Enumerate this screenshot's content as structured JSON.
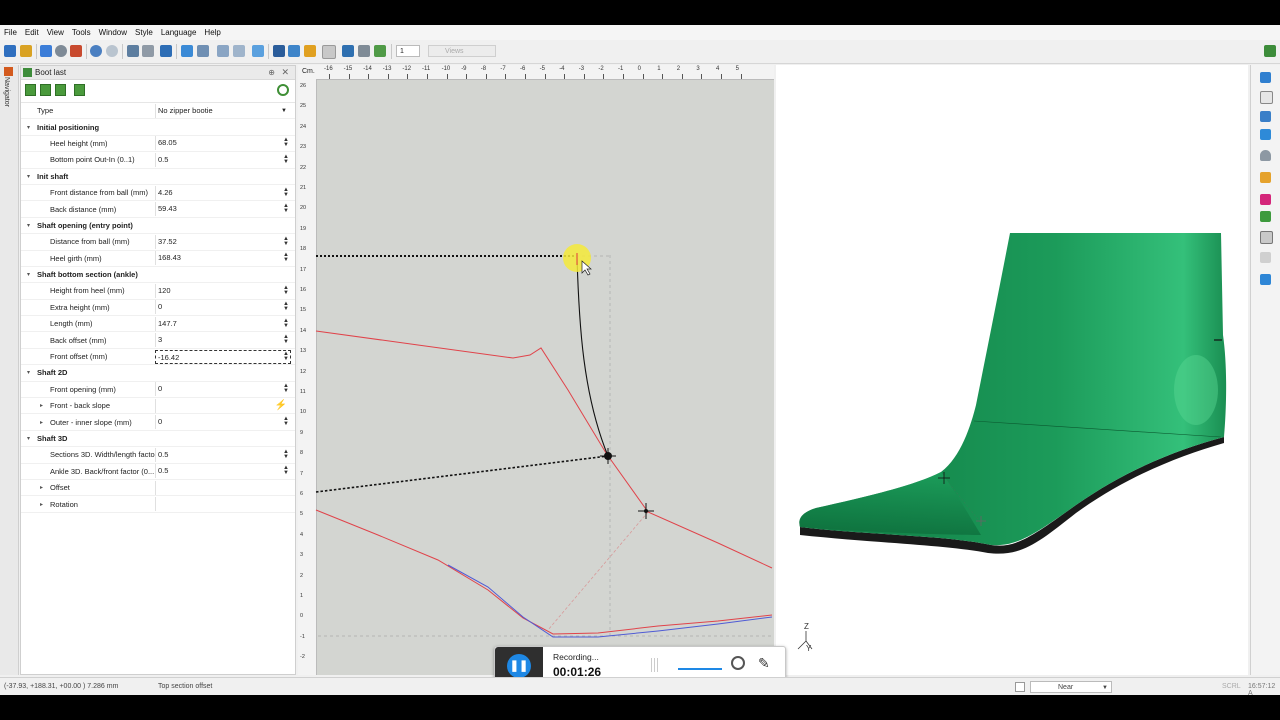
{
  "menu": [
    "File",
    "Edit",
    "View",
    "Tools",
    "Window",
    "Style",
    "Language",
    "Help"
  ],
  "toolbar": {
    "step_value": "1",
    "views_label": "Views"
  },
  "navigator_tab": "Navigator",
  "panel": {
    "title": "Boot last",
    "rows": [
      {
        "kind": "prop",
        "label": "Type",
        "value": "No zipper bootie",
        "control": "dropdown"
      },
      {
        "kind": "cat",
        "label": "Initial positioning"
      },
      {
        "kind": "prop",
        "label": "Heel height (mm)",
        "value": "68.05",
        "control": "spin"
      },
      {
        "kind": "prop",
        "label": "Bottom point Out-In (0..1)",
        "value": "0.5",
        "control": "spin"
      },
      {
        "kind": "cat",
        "label": "Init shaft"
      },
      {
        "kind": "prop",
        "label": "Front distance from ball (mm)",
        "value": "4.26",
        "control": "spin"
      },
      {
        "kind": "prop",
        "label": "Back distance (mm)",
        "value": "59.43",
        "control": "spin"
      },
      {
        "kind": "cat",
        "label": "Shaft opening (entry point)"
      },
      {
        "kind": "prop",
        "label": "Distance from ball (mm)",
        "value": "37.52",
        "control": "spin"
      },
      {
        "kind": "prop",
        "label": "Heel girth (mm)",
        "value": "168.43",
        "control": "spin"
      },
      {
        "kind": "cat",
        "label": "Shaft bottom section (ankle)"
      },
      {
        "kind": "prop",
        "label": "Height from heel (mm)",
        "value": "120",
        "control": "spin"
      },
      {
        "kind": "prop",
        "label": "Extra height (mm)",
        "value": "0",
        "control": "spin"
      },
      {
        "kind": "prop",
        "label": "Length (mm)",
        "value": "147.7",
        "control": "spin"
      },
      {
        "kind": "prop",
        "label": "Back offset (mm)",
        "value": "3",
        "control": "spin"
      },
      {
        "kind": "prop",
        "label": "Front offset (mm)",
        "value": "-16.42",
        "control": "spin",
        "active": true
      },
      {
        "kind": "cat",
        "label": "Shaft 2D"
      },
      {
        "kind": "prop",
        "label": "Front opening (mm)",
        "value": "0",
        "control": "spin"
      },
      {
        "kind": "sub",
        "label": "Front - back slope",
        "value": "",
        "control": "lightning"
      },
      {
        "kind": "sub",
        "label": "Outer - inner slope (mm)",
        "value": "0",
        "control": "spin"
      },
      {
        "kind": "cat",
        "label": "Shaft 3D"
      },
      {
        "kind": "prop",
        "label": "Sections 3D. Width/length factor",
        "value": "0.5",
        "control": "spin"
      },
      {
        "kind": "prop",
        "label": "Ankle 3D. Back/front factor (0...",
        "value": "0.5",
        "control": "spin"
      },
      {
        "kind": "sub",
        "label": "Offset",
        "value": "",
        "control": "none"
      },
      {
        "kind": "sub",
        "label": "Rotation",
        "value": "",
        "control": "none"
      }
    ]
  },
  "view2d": {
    "unit_label": "Cm.",
    "top_ticks": [
      "-16",
      "-15",
      "-14",
      "-13",
      "-12",
      "-11",
      "-10",
      "-9",
      "-8",
      "-7",
      "-6",
      "-5",
      "-4",
      "-3",
      "-2",
      "-1",
      "0",
      "1",
      "2",
      "3",
      "4",
      "5"
    ],
    "left_ticks": [
      "26",
      "25",
      "24",
      "23",
      "22",
      "21",
      "20",
      "19",
      "18",
      "17",
      "16",
      "15",
      "14",
      "13",
      "12",
      "11",
      "10",
      "9",
      "8",
      "7",
      "6",
      "5",
      "4",
      "3",
      "2",
      "1",
      "0",
      "-1",
      "-2"
    ]
  },
  "view3d": {
    "axis_z": "Z",
    "axis_y": "Y",
    "boot_color": "#1e9a5a",
    "sole_color": "#1a1a1a"
  },
  "recording": {
    "status": "Recording...",
    "time": "00:01:26"
  },
  "status": {
    "coords": "(-37.93, +188.31, +00.00 )   7.286 mm",
    "message": "Top section offset",
    "snap_mode": "Near",
    "scroll": "SCRL",
    "time": "16:57:12 A"
  }
}
